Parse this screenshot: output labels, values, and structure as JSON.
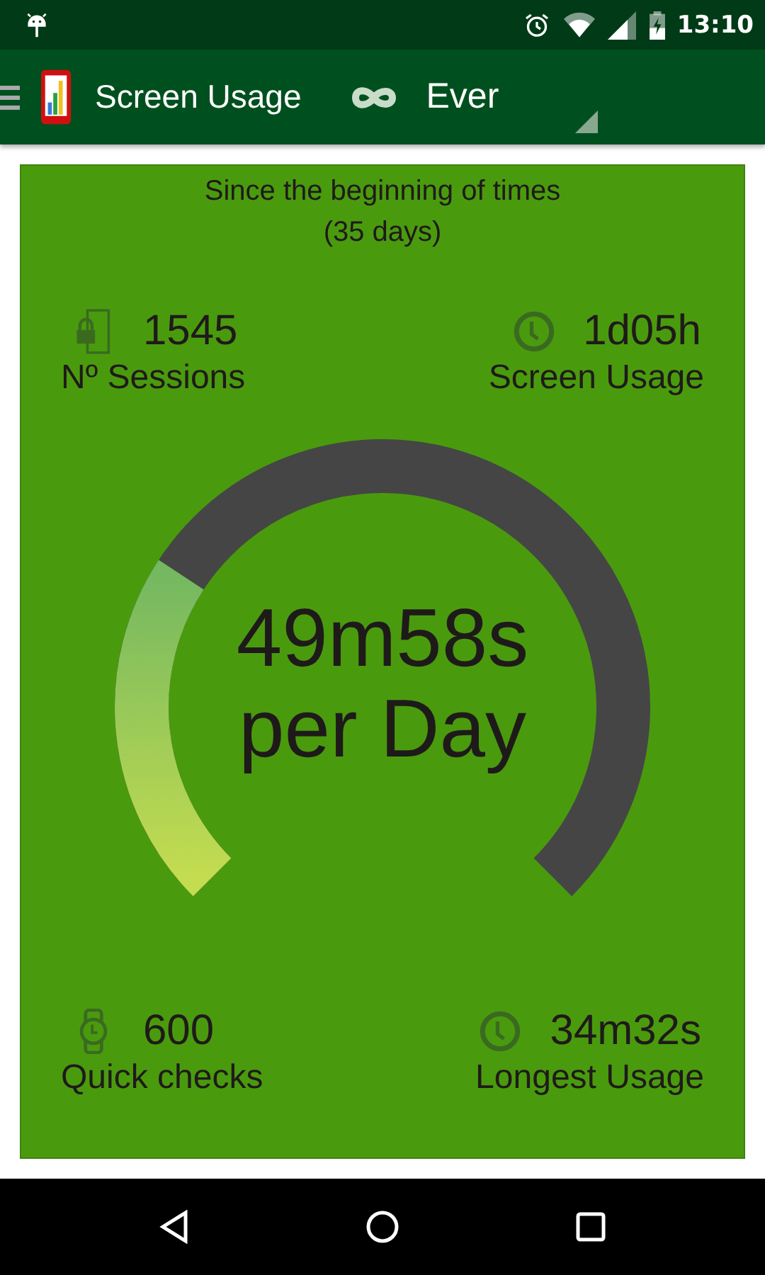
{
  "status_bar": {
    "time": "13:10"
  },
  "app_bar": {
    "title": "Screen Usage",
    "period": "Ever"
  },
  "card": {
    "heading": "Since the beginning of times",
    "subheading": "(35 days)",
    "top_stats": [
      {
        "kind": "lock",
        "value": "1545",
        "label": "Nº Sessions"
      },
      {
        "kind": "clock",
        "value": "1d05h",
        "label": "Screen Usage"
      }
    ],
    "gauge": {
      "value": "49m58s",
      "unit": "per Day"
    },
    "bottom_stats": [
      {
        "kind": "watch",
        "value": "600",
        "label": "Quick checks"
      },
      {
        "kind": "clock",
        "value": "34m32s",
        "label": "Longest Usage"
      }
    ]
  }
}
